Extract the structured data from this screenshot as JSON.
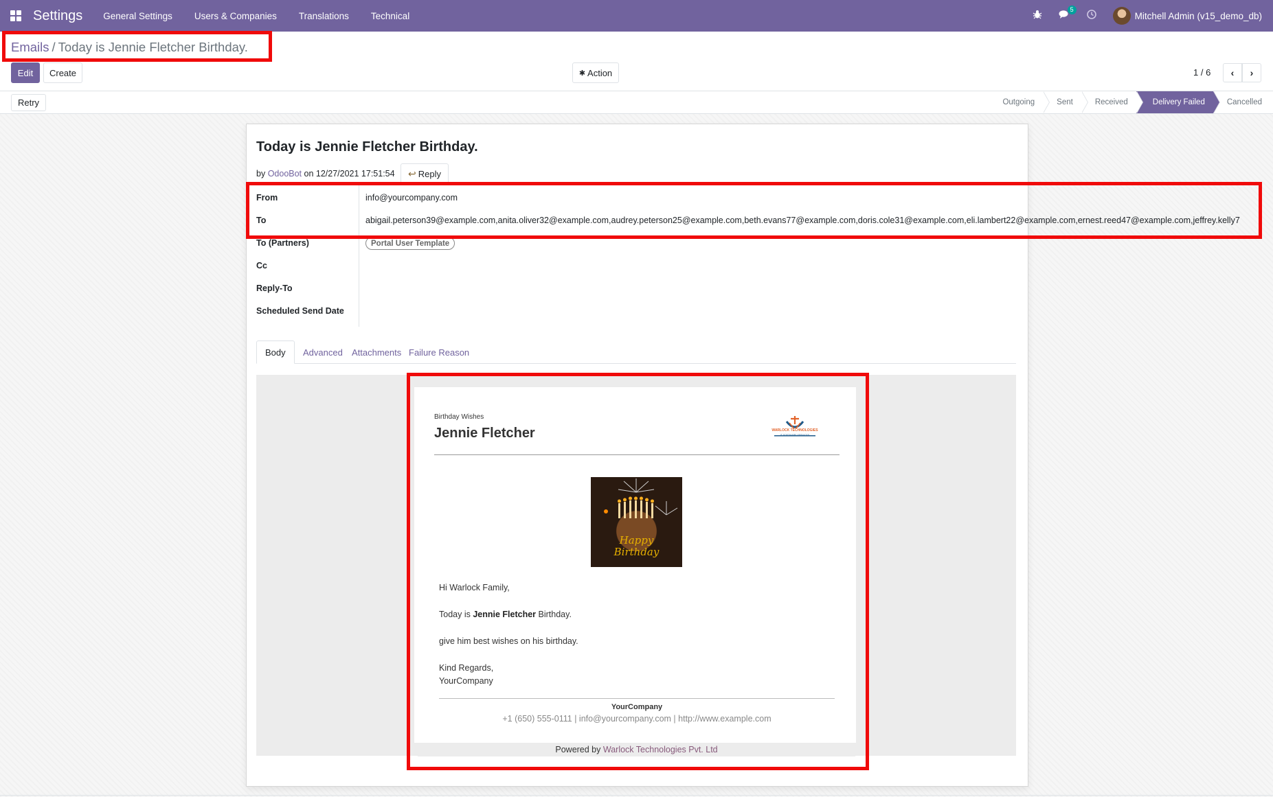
{
  "navbar": {
    "app_title": "Settings",
    "menu": [
      "General Settings",
      "Users & Companies",
      "Translations",
      "Technical"
    ],
    "messages_badge": "5",
    "user": "Mitchell Admin (v15_demo_db)"
  },
  "breadcrumb": {
    "parent": "Emails",
    "current": "Today is Jennie Fletcher Birthday."
  },
  "buttons": {
    "edit": "Edit",
    "create": "Create",
    "action": "Action",
    "retry": "Retry"
  },
  "pager": {
    "value": "1 / 6"
  },
  "statusbar": [
    "Outgoing",
    "Sent",
    "Received",
    "Delivery Failed",
    "Cancelled"
  ],
  "email": {
    "subject": "Today is Jennie Fletcher Birthday.",
    "by_prefix": "by",
    "author": "OdooBot",
    "on_date": "on 12/27/2021 17:51:54",
    "reply": "Reply",
    "fields": {
      "from_label": "From",
      "from_value": "info@yourcompany.com",
      "to_label": "To",
      "to_value": "abigail.peterson39@example.com,anita.oliver32@example.com,audrey.peterson25@example.com,beth.evans77@example.com,doris.cole31@example.com,eli.lambert22@example.com,ernest.reed47@example.com,jeffrey.kelly7",
      "to_partners_label": "To (Partners)",
      "to_partners_tag": "Portal User Template",
      "cc_label": "Cc",
      "reply_to_label": "Reply-To",
      "scheduled_label": "Scheduled Send Date"
    }
  },
  "tabs": [
    "Body",
    "Advanced",
    "Attachments",
    "Failure Reason"
  ],
  "mail_body": {
    "small_heading": "Birthday Wishes",
    "name": "Jennie Fletcher",
    "logo_text": "WARLOCK TECHNOLOGIES",
    "logo_sub": "IT SOFTWARE SERVICES",
    "cake_text_1": "Happy",
    "cake_text_2": "Birthday",
    "greeting": "Hi Warlock Family,",
    "line1_prefix": "Today is",
    "line1_name": "Jennie Fletcher",
    "line1_suffix": "Birthday.",
    "line2": "give him best wishes on his birthday.",
    "regards": "Kind Regards,",
    "signature": "YourCompany",
    "company": "YourCompany",
    "company_info": "+1 (650) 555-0111 | info@yourcompany.com | http://www.example.com",
    "powered_prefix": "Powered by",
    "powered_link": "Warlock Technologies Pvt. Ltd"
  }
}
